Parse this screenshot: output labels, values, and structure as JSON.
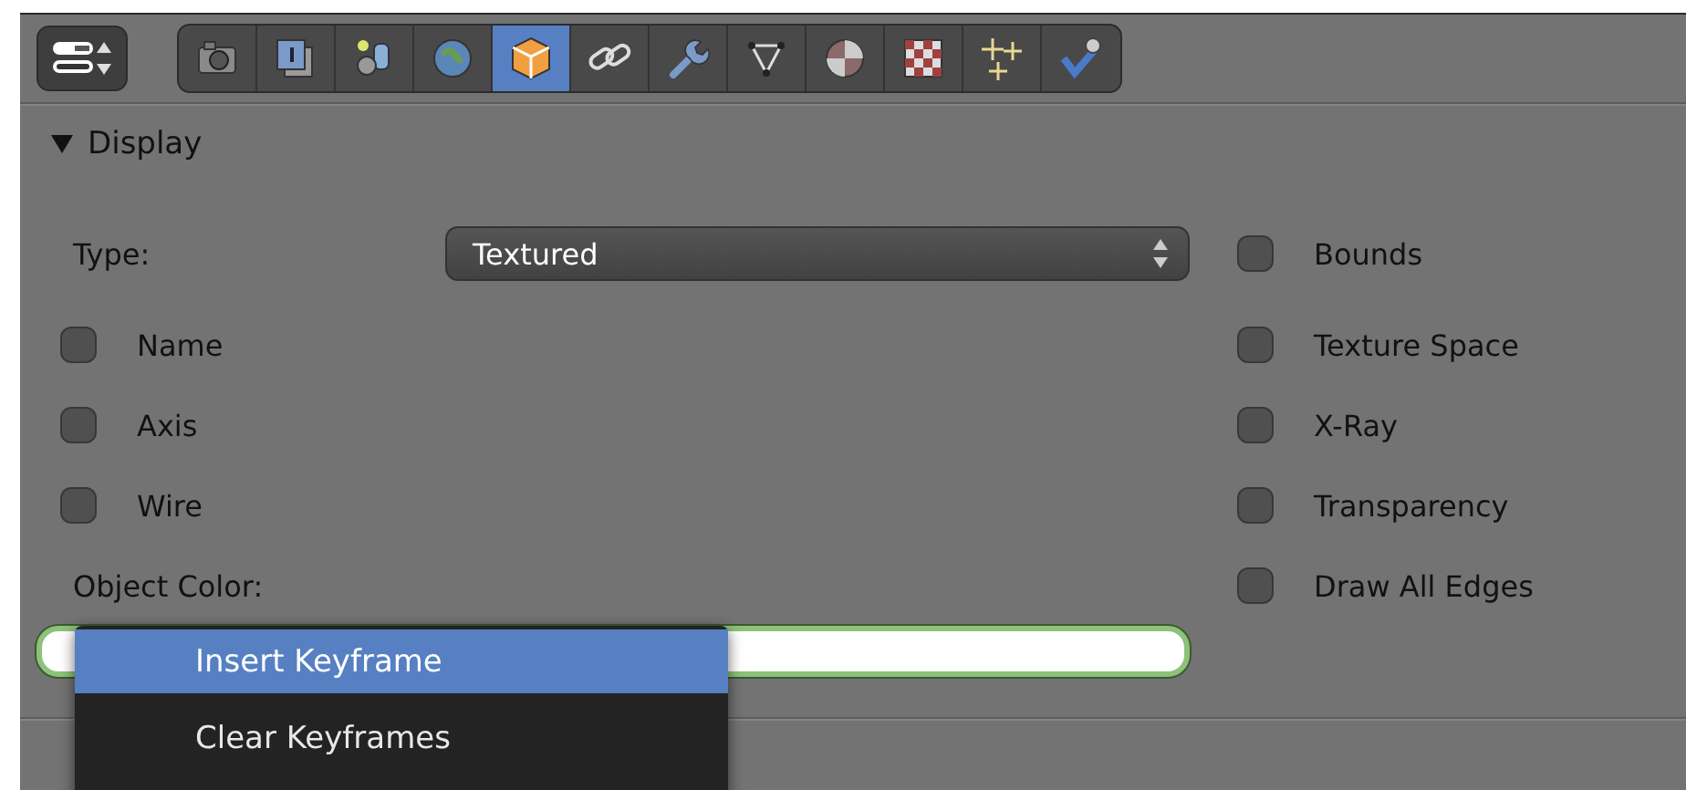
{
  "toolbar": {
    "context_selector": {
      "kind": "properties"
    },
    "tabs": [
      {
        "kind": "render",
        "selected": false
      },
      {
        "kind": "layers",
        "selected": false
      },
      {
        "kind": "scene",
        "selected": false
      },
      {
        "kind": "world",
        "selected": false
      },
      {
        "kind": "object",
        "selected": true
      },
      {
        "kind": "constraints",
        "selected": false
      },
      {
        "kind": "modifiers",
        "selected": false
      },
      {
        "kind": "mesh",
        "selected": false
      },
      {
        "kind": "material",
        "selected": false
      },
      {
        "kind": "texture",
        "selected": false
      },
      {
        "kind": "particles",
        "selected": false
      },
      {
        "kind": "physics",
        "selected": false
      }
    ]
  },
  "panel": {
    "title": "Display",
    "expanded": true,
    "type_label": "Type:",
    "type_value": "Textured",
    "left_options": [
      {
        "label": "Name",
        "checked": false
      },
      {
        "label": "Axis",
        "checked": false
      },
      {
        "label": "Wire",
        "checked": false
      }
    ],
    "color_label": "Object Color:",
    "right_options": [
      {
        "label": "Bounds",
        "checked": false
      },
      {
        "label": "Texture Space",
        "checked": false
      },
      {
        "label": "X-Ray",
        "checked": false
      },
      {
        "label": "Transparency",
        "checked": false
      },
      {
        "label": "Draw All Edges",
        "checked": false
      }
    ]
  },
  "context_menu": {
    "items": [
      {
        "label": "Insert Keyframe",
        "selected": true
      },
      {
        "label": "Clear Keyframes",
        "selected": false
      }
    ]
  }
}
